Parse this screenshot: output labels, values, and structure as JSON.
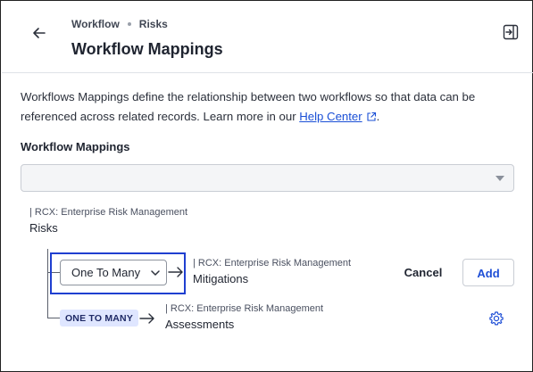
{
  "header": {
    "breadcrumb": [
      "Workflow",
      "Risks"
    ],
    "title": "Workflow Mappings"
  },
  "description": {
    "text": "Workflows Mappings define the relationship between two workflows so that data can be referenced across related records. Learn more in our ",
    "link_label": "Help Center",
    "trailing": "."
  },
  "section": {
    "label": "Workflow Mappings",
    "select_value": ""
  },
  "root": {
    "app_label": "| RCX: Enterprise Risk Management",
    "workflow": "Risks"
  },
  "mappings": [
    {
      "relationship_value": "One To Many",
      "app_label": "| RCX: Enterprise Risk Management",
      "workflow": "Mitigations",
      "cancel_label": "Cancel",
      "add_label": "Add"
    },
    {
      "relationship_badge": "ONE TO MANY",
      "app_label": "| RCX: Enterprise Risk Management",
      "workflow": "Assessments"
    }
  ],
  "icons": {
    "back": "arrow-left-icon",
    "collapse": "panel-collapse-icon",
    "external_link": "external-link-icon",
    "dropdown": "caret-down-icon",
    "chevron": "chevron-down-icon",
    "arrow": "arrow-right-icon",
    "settings": "gear-icon"
  },
  "colors": {
    "link": "#1a4fd6",
    "highlight_border": "#1f3fd0",
    "badge_bg": "#dfe6ff"
  }
}
